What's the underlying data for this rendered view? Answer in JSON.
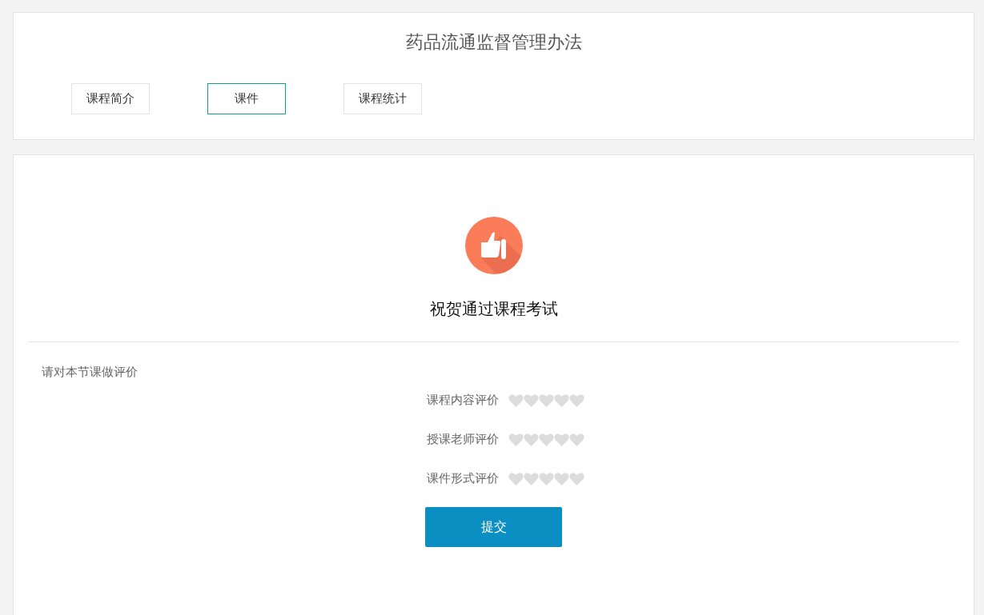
{
  "course": {
    "title": "药品流通监督管理办法"
  },
  "tabs": [
    {
      "label": "课程简介",
      "selected": false
    },
    {
      "label": "课件",
      "selected": true
    },
    {
      "label": "课程统计",
      "selected": false
    }
  ],
  "result": {
    "message": "祝贺通过课程考试"
  },
  "rating": {
    "prompt": "请对本节课做评价",
    "items": [
      {
        "label": "课程内容评价",
        "stars": 0
      },
      {
        "label": "授课老师评价",
        "stars": 0
      },
      {
        "label": "课件形式评价",
        "stars": 0
      }
    ],
    "submit": "提交"
  }
}
